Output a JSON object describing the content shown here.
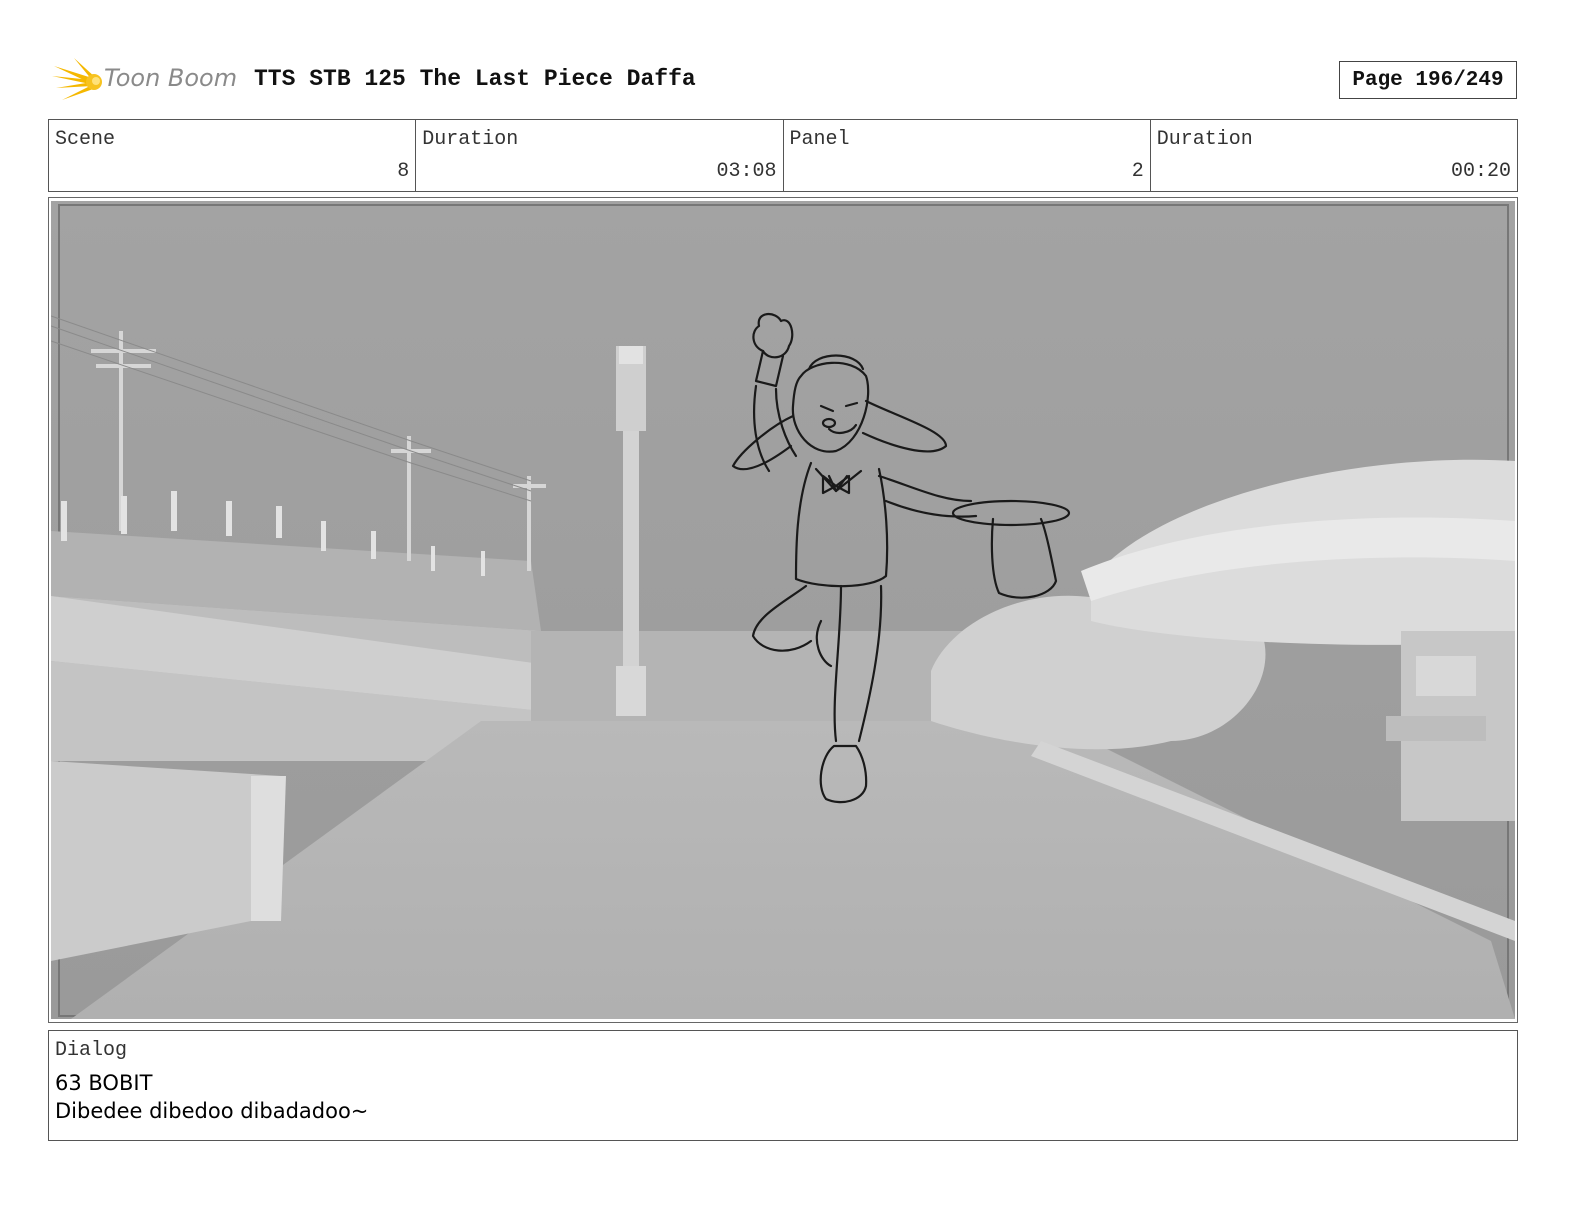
{
  "header": {
    "logo_text": "Toon Boom",
    "title": "TTS STB 125 The Last Piece Daffa",
    "page_label": "Page 196/249"
  },
  "info": {
    "scene_label": "Scene",
    "scene_value": "8",
    "scene_duration_label": "Duration",
    "scene_duration_value": "03:08",
    "panel_label": "Panel",
    "panel_value": "2",
    "panel_duration_label": "Duration",
    "panel_duration_value": "00:20"
  },
  "dialog": {
    "label": "Dialog",
    "speaker": "63 BOBIT",
    "line": "Dibedee dibedoo dibadadoo~"
  },
  "colors": {
    "logo_accent": "#f5b800",
    "frame_border": "#555555"
  },
  "icons": [
    "toon-boom-logo-icon"
  ]
}
